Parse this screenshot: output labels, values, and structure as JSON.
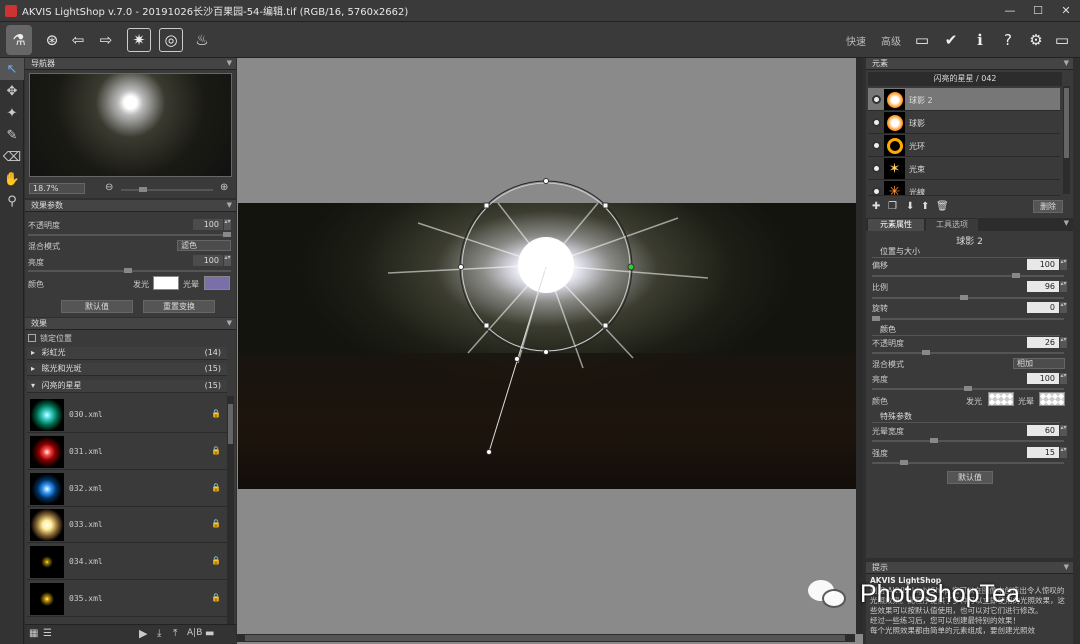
{
  "window": {
    "title": "AKVIS LightShop v.7.0 - 20191026长沙百果园-54-编辑.tif (RGB/16, 5760x2662)"
  },
  "toolbar": {
    "fast_label": "快速",
    "advanced_label": "高级"
  },
  "navigator": {
    "title": "导航器",
    "zoom": "18.7%"
  },
  "effect_params": {
    "title": "效果参数",
    "opacity_label": "不透明度",
    "opacity_value": "100",
    "blend_label": "混合模式",
    "blend_value": "滤色",
    "brightness_label": "亮度",
    "brightness_value": "100",
    "color_label": "颜色",
    "glow_label": "发光",
    "halo_label": "光晕",
    "default_button": "默认值",
    "reset_button": "重置变换",
    "glow_color": "#ffffff",
    "halo_color": "#7a6fa8"
  },
  "effects": {
    "title": "效果",
    "lock_position": "锁定位置",
    "groups": [
      {
        "label": "彩虹光",
        "count": "(14)"
      },
      {
        "label": "眩光和光斑",
        "count": "(15)"
      },
      {
        "label": "闪亮的星星",
        "count": "(15)"
      }
    ],
    "items": [
      {
        "label": "030.xml"
      },
      {
        "label": "031.xml"
      },
      {
        "label": "032.xml"
      },
      {
        "label": "033.xml"
      },
      {
        "label": "034.xml"
      },
      {
        "label": "035.xml"
      }
    ]
  },
  "elements": {
    "title": "元素",
    "preset_name": "闪亮的星星 / 042",
    "items": [
      {
        "label": "球影 2"
      },
      {
        "label": "球影"
      },
      {
        "label": "光环"
      },
      {
        "label": "光束"
      },
      {
        "label": "光線"
      }
    ],
    "delete_button": "删除"
  },
  "props": {
    "tab_element": "元素属性",
    "tab_tool": "工具选项",
    "element_name": "球影 2",
    "position_size": "位置与大小",
    "offset_label": "偏移",
    "offset_value": "100",
    "scale_label": "比例",
    "scale_value": "96",
    "rotate_label": "旋转",
    "rotate_value": "0",
    "color_section": "颜色",
    "opacity_label": "不透明度",
    "opacity_value": "26",
    "blend_label": "混合模式",
    "blend_value": "相加",
    "brightness_label": "亮度",
    "brightness_value": "100",
    "color_label": "颜色",
    "glow_label": "发光",
    "halo_label": "光晕",
    "special_section": "特殊参数",
    "halo_width_label": "光晕宽度",
    "halo_width_value": "60",
    "intensity_label": "强度",
    "intensity_value": "15",
    "default_button": "默认值"
  },
  "hint": {
    "title": "提示",
    "text_lines": [
      "AKVIS LightShop",
      "利用 AKVIS LightShop 您可以在图像中创造出令人惊叹的光照效果。此程序提供了多种可以立即使用的光照效果，这些效果可以按默认值使用，也可以对它们进行修改。",
      "经过一些练习后，您可以创建最特别的效果！",
      "每个光照效果都由简单的元素组成，要创建光照效"
    ]
  },
  "watermark": {
    "text": "PhotoshopTea"
  }
}
